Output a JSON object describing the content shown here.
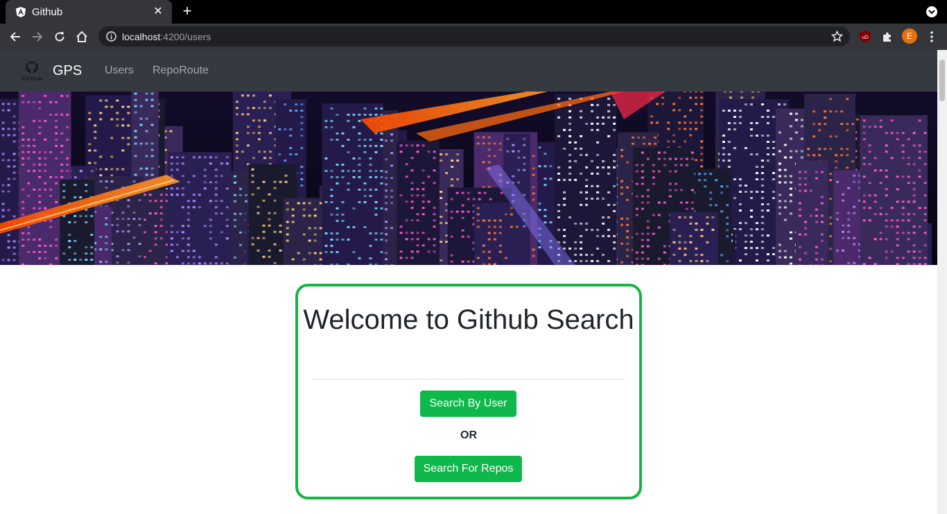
{
  "browser": {
    "tab_title": "Github",
    "tab_close": "✕",
    "new_tab": "+",
    "url_host": "localhost",
    "url_path": ":4200/users",
    "avatar_letter": "E"
  },
  "navbar": {
    "logo_text": "GitHub",
    "brand": "GPS",
    "links": [
      {
        "label": "Users"
      },
      {
        "label": "RepoRoute"
      }
    ]
  },
  "card": {
    "title": "Welcome to Github Search",
    "search_user_button": "Search By User",
    "or_text": "OR",
    "search_repos_button": "Search For Repos"
  },
  "colors": {
    "navbar_bg": "#343a40",
    "accent_green": "#13b543",
    "button_green": "#0fb84b",
    "browser_dark": "#35363a"
  }
}
